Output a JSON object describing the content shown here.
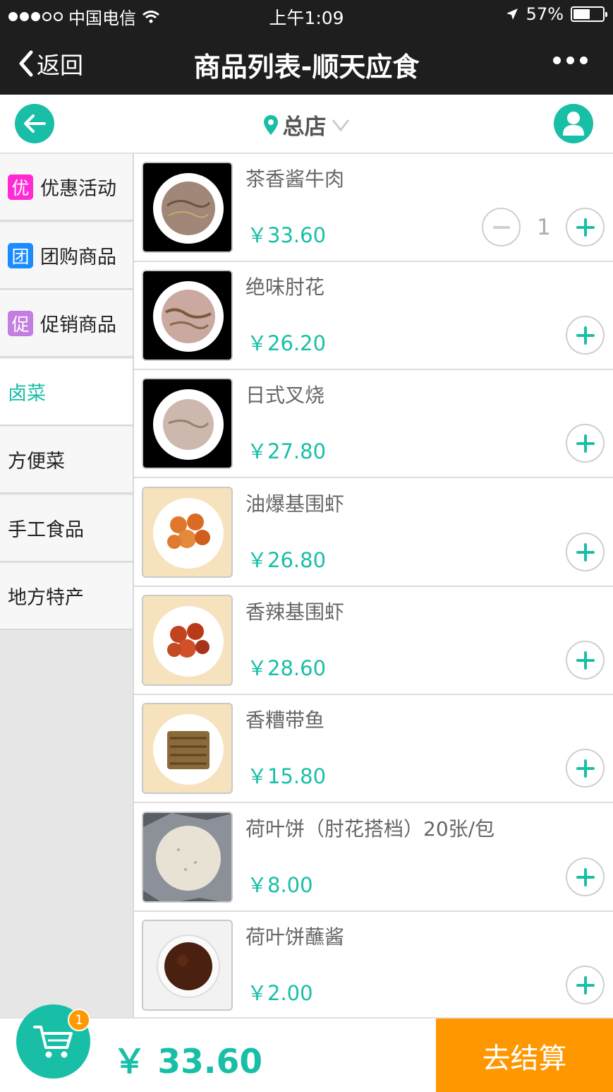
{
  "status_bar": {
    "carrier": "中国电信",
    "time": "上午1:09",
    "battery": "57%",
    "battery_level": 0.57
  },
  "nav": {
    "back_label": "返回",
    "title": "商品列表-顺天应食"
  },
  "store": {
    "name": "总店"
  },
  "categories": [
    {
      "icon_text": "优",
      "label": "优惠活动",
      "icon_color": "#ff2ad4"
    },
    {
      "icon_text": "团",
      "label": "团购商品",
      "icon_color": "#1a8cff"
    },
    {
      "icon_text": "促",
      "label": "促销商品",
      "icon_color": "#c47ee0"
    },
    {
      "label": "卤菜",
      "active": true
    },
    {
      "label": "方便菜"
    },
    {
      "label": "手工食品"
    },
    {
      "label": "地方特产"
    }
  ],
  "products": [
    {
      "name": "茶香酱牛肉",
      "price": "￥33.60",
      "quantity": "1"
    },
    {
      "name": "绝味肘花",
      "price": "￥26.20"
    },
    {
      "name": "日式叉烧",
      "price": "￥27.80"
    },
    {
      "name": "油爆基围虾",
      "price": "￥26.80"
    },
    {
      "name": "香辣基围虾",
      "price": "￥28.60"
    },
    {
      "name": "香糟带鱼",
      "price": "￥15.80"
    },
    {
      "name": "荷叶饼（肘花搭档）20张/包",
      "price": "￥8.00"
    },
    {
      "name": "荷叶饼蘸酱",
      "price": "￥2.00"
    }
  ],
  "cart": {
    "count": "1",
    "total": "￥ 33.60",
    "checkout_label": "去结算"
  },
  "colors": {
    "accent": "#18bfa6",
    "checkout": "#ff9800",
    "dark_bar": "#1e1e1e"
  },
  "icons": [
    "back-chevron-icon",
    "more-dots-icon",
    "back-arrow-icon",
    "location-pin-icon",
    "dropdown-chevron-icon",
    "user-icon",
    "minus-icon",
    "plus-icon",
    "cart-icon"
  ]
}
